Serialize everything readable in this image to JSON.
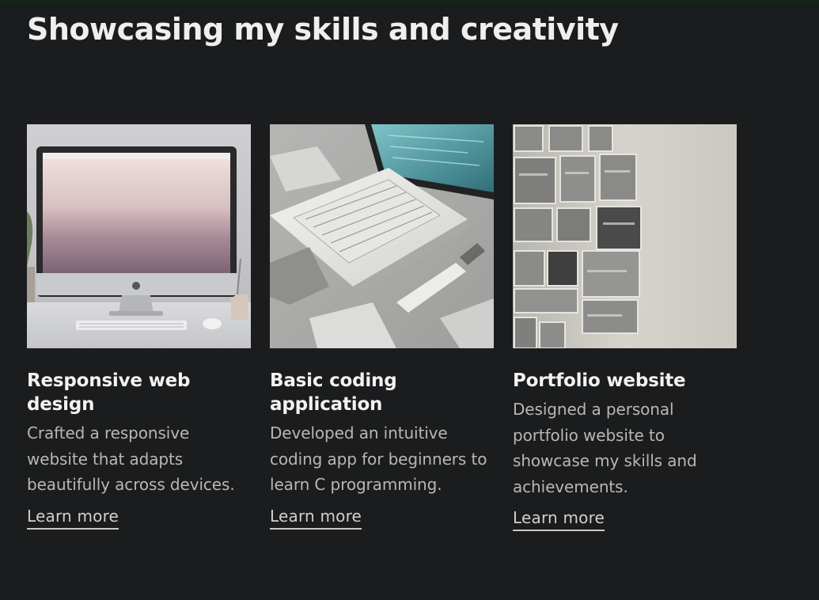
{
  "section": {
    "title": "Showcasing my skills and creativity"
  },
  "projects": [
    {
      "title": "Responsive web design",
      "description": "Crafted a responsive website that adapts beautifully across devices.",
      "link_label": "Learn more",
      "image": "desktop-computer-illustration"
    },
    {
      "title": "Basic coding application",
      "description": "Developed an intuitive coding app for beginners to learn C programming.",
      "link_label": "Learn more",
      "image": "laptop-keyboard-illustration"
    },
    {
      "title": "Portfolio website",
      "description": "Designed a personal portfolio website to showcase my skills and achievements.",
      "link_label": "Learn more",
      "image": "portfolio-grid-illustration"
    }
  ],
  "colors": {
    "background": "#1b1c1d",
    "title": "#efefef",
    "body_text": "#b8b8b2",
    "link": "#d0d0cc"
  }
}
